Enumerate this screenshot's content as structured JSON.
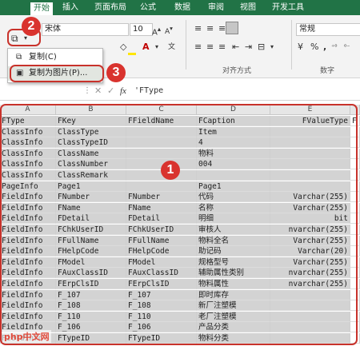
{
  "ribbon_tabs": [
    "开始",
    "插入",
    "页面布局",
    "公式",
    "数据",
    "审阅",
    "视图",
    "开发工具"
  ],
  "font": {
    "name": "宋体",
    "size": "10"
  },
  "number_format": "常规",
  "groups": {
    "align": "对齐方式",
    "number": "数字"
  },
  "menu": {
    "copy": "复制(C)",
    "copy_picture": "复制为图片(P)..."
  },
  "formula": {
    "fx": "fx",
    "content": "'FType"
  },
  "callouts": {
    "one": "1",
    "two": "2",
    "three": "3"
  },
  "columns": [
    "A",
    "B",
    "C",
    "D",
    "E"
  ],
  "rows": [
    [
      "FType",
      "FKey",
      "FFieldName",
      "FCaption",
      "FValueType",
      "F"
    ],
    [
      "ClassInfo",
      "ClassType",
      "",
      "Item",
      "",
      ""
    ],
    [
      "ClassInfo",
      "ClassTypeID",
      "",
      "4",
      "",
      ""
    ],
    [
      "ClassInfo",
      "ClassName",
      "",
      "物料",
      "",
      ""
    ],
    [
      "ClassInfo",
      "ClassNumber",
      "",
      "004",
      "",
      ""
    ],
    [
      "ClassInfo",
      "ClassRemark",
      "",
      "",
      "",
      ""
    ],
    [
      "PageInfo",
      "Page1",
      "",
      "Page1",
      "",
      ""
    ],
    [
      "FieldInfo",
      "FNumber",
      "FNumber",
      "代码",
      "Varchar(255)",
      ""
    ],
    [
      "FieldInfo",
      "FName",
      "FName",
      "名称",
      "Varchar(255)",
      ""
    ],
    [
      "FieldInfo",
      "FDetail",
      "FDetail",
      "明细",
      "bit",
      ""
    ],
    [
      "FieldInfo",
      "FChkUserID",
      "FChkUserID",
      "审核人",
      "nvarchar(255)",
      ""
    ],
    [
      "FieldInfo",
      "FFullName",
      "FFullName",
      "物料全名",
      "Varchar(255)",
      ""
    ],
    [
      "FieldInfo",
      "FHelpCode",
      "FHelpCode",
      "助记码",
      "Varchar(20)",
      ""
    ],
    [
      "FieldInfo",
      "FModel",
      "FModel",
      "规格型号",
      "Varchar(255)",
      ""
    ],
    [
      "FieldInfo",
      "FAuxClassID",
      "FAuxClassID",
      "辅助属性类别",
      "nvarchar(255)",
      ""
    ],
    [
      "FieldInfo",
      "FErpClsID",
      "FErpClsID",
      "物料属性",
      "nvarchar(255)",
      ""
    ],
    [
      "FieldInfo",
      "F_107",
      "F_107",
      "即时库存",
      "",
      ""
    ],
    [
      "FieldInfo",
      "F_108",
      "F_108",
      "新厂注塑模",
      "",
      ""
    ],
    [
      "FieldInfo",
      "F_110",
      "F_110",
      "老厂注塑模",
      "",
      ""
    ],
    [
      "FieldInfo",
      "F_106",
      "F_106",
      "产品分类",
      "",
      ""
    ],
    [
      "FieldInfo",
      "FTypeID",
      "FTypeID",
      "物料分类",
      "",
      ""
    ]
  ],
  "watermark": "php中文网"
}
